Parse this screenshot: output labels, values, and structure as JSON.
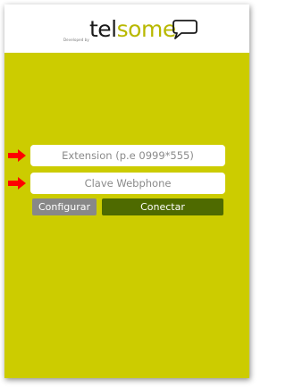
{
  "branding": {
    "developed_by": "Developed by",
    "logo_part1": "tel",
    "logo_part2": "some"
  },
  "form": {
    "extension_placeholder": "Extension (p.e 0999*555)",
    "password_placeholder": "Clave Webphone"
  },
  "buttons": {
    "configure_label": "Configurar",
    "connect_label": "Conectar"
  },
  "icons": {
    "pointer_arrow": "right-arrow-icon",
    "logo_bubble": "speech-bubble-icon"
  },
  "colors": {
    "panel_background": "#cccc00",
    "logo_dark": "#1a1a1a",
    "logo_accent": "#b8b800",
    "configure_button": "#888888",
    "connect_button": "#4e6a00",
    "arrow": "#ff0000"
  }
}
